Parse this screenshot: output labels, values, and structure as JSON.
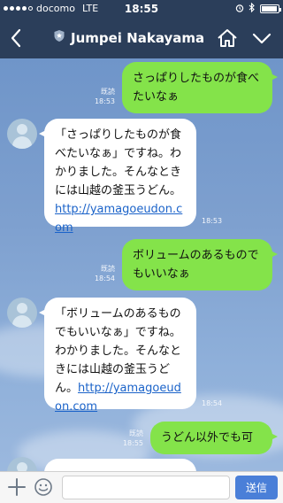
{
  "status_bar": {
    "carrier": "docomo",
    "network": "LTE",
    "time": "18:55",
    "signal_bars": 4,
    "battery_level": 0.85
  },
  "header": {
    "title": "Jumpei Nakayama",
    "back_icon": "chevron-left-icon",
    "badge_icon": "official-shield-icon",
    "home_icon": "home-icon",
    "menu_icon": "chevron-down-icon"
  },
  "messages": [
    {
      "direction": "out",
      "read_label": "既読",
      "time": "18:53",
      "text": "さっぱりしたものが食べたいなぁ"
    },
    {
      "direction": "in",
      "time": "18:53",
      "text": "「さっぱりしたものが食べたいなぁ」ですね。わかりました。そんなときには山越の釜玉うどん。",
      "link": "http://yamagoeudon.com"
    },
    {
      "direction": "out",
      "read_label": "既読",
      "time": "18:54",
      "text": "ボリュームのあるものでもいいなぁ"
    },
    {
      "direction": "in",
      "time": "18:54",
      "text": "「ボリュームのあるものでもいいなぁ」ですね。わかりました。そんなときには山越の釜玉うどん。",
      "link": "http://yamagoeudon.com"
    },
    {
      "direction": "out",
      "read_label": "既読",
      "time": "18:55",
      "text": "うどん以外でも可"
    }
  ],
  "input_bar": {
    "placeholder": "",
    "send_label": "送信"
  },
  "colors": {
    "header_bg": "#2b3e5a",
    "outgoing_bubble": "#84e34a",
    "incoming_bubble": "#ffffff",
    "link": "#1b63c9",
    "send_button": "#4a7fd8"
  }
}
